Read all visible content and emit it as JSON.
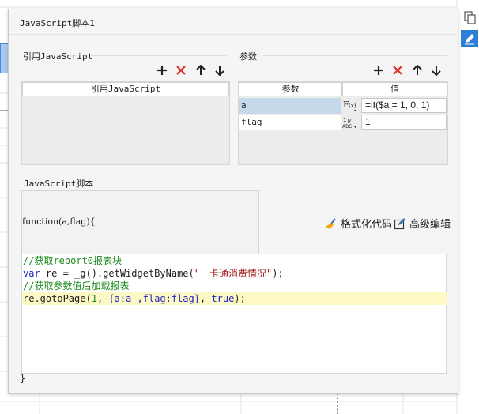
{
  "dialog": {
    "title": "JavaScript脚本1"
  },
  "refs": {
    "section_label": "引用JavaScript",
    "column_header": "引用JavaScript"
  },
  "params": {
    "section_label": "参数",
    "columns": [
      "参数",
      "值"
    ],
    "rows": [
      {
        "name": "a",
        "type_icon": "formula-icon",
        "value": "=if($a = 1, 0, 1)"
      },
      {
        "name": "flag",
        "type_icon": "text-type-icon",
        "value": "1"
      }
    ]
  },
  "script": {
    "section_label": "JavaScript脚本",
    "signature": "function(a,flag){",
    "format_label": "格式化代码",
    "advanced_label": "高级编辑",
    "closing": "}"
  },
  "code_lines": {
    "l1": "//获取report0报表块",
    "l2a": "var",
    "l2b": " re = _g().getWidgetByName(",
    "l2c": "\"一卡通消费情况\"",
    "l2d": ");",
    "l3": "//获取参数值后加载报表",
    "l4a": "re.gotoPage(",
    "l4b": "1",
    "l4c": ", ",
    "l4d": "{a:a ,flag:flag}",
    "l4e": ", ",
    "l4f": "true",
    "l4g": ");"
  },
  "colors": {
    "accent": "#2d7fd4",
    "delete": "#e0322d",
    "selected_row": "#c5d9ea",
    "highlight_line": "#fdf9c4"
  }
}
